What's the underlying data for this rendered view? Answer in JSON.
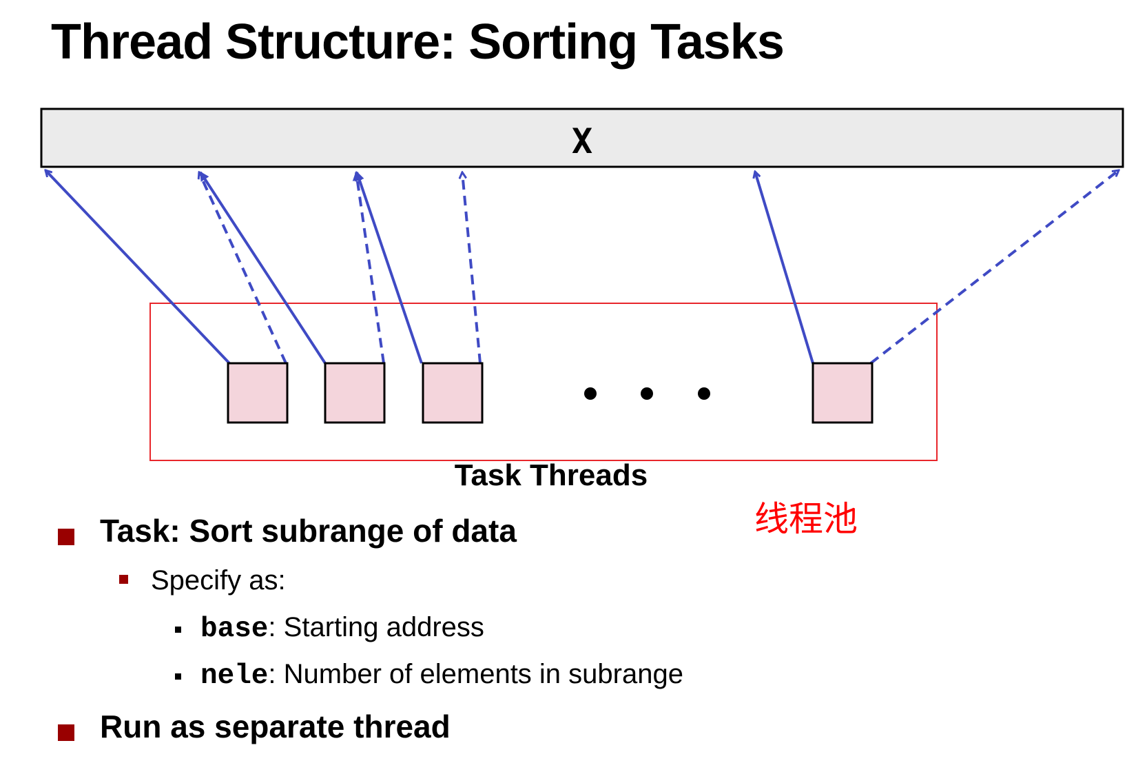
{
  "title": "Thread Structure: Sorting Tasks",
  "diagram": {
    "array_label": "X",
    "task_threads_label": "Task Threads",
    "ellipsis": "• • •",
    "pool_label": "线程池",
    "colors": {
      "array_fill": "#ebebeb",
      "thread_fill": "#f4d5dc",
      "arrow": "#3f4ac4",
      "pool_border": "#e8262b",
      "pool_label": "#ff0000"
    }
  },
  "bullets": {
    "task": "Task: Sort subrange of data",
    "specify": "Specify as:",
    "base_code": "base",
    "base_desc": ": Starting address",
    "nele_code": "nele",
    "nele_desc": ": Number of elements in subrange",
    "run": "Run as separate thread"
  }
}
